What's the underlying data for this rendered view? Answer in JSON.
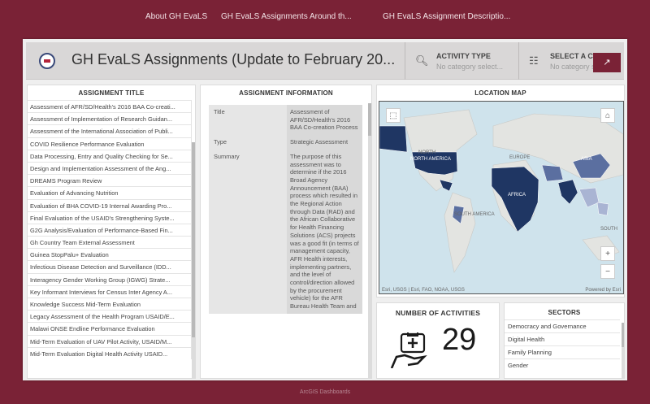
{
  "nav": {
    "items": [
      {
        "label": "About GH EvaLS"
      },
      {
        "label": "GH EvaLS Assignments Around th..."
      },
      {
        "label": "GH EvaLS Assignment Descriptio..."
      }
    ]
  },
  "header": {
    "title": "GH EvaLS Assignments (Update to February 20...",
    "activity_type": {
      "label": "ACTIVITY TYPE",
      "placeholder": "No category select..."
    },
    "country": {
      "label": "SELECT A CO",
      "placeholder": "No category se"
    }
  },
  "assignments": {
    "heading": "ASSIGNMENT TITLE",
    "items": [
      "Assessment of AFR/SD/Health's 2016 BAA Co-creati...",
      "Assessment of Implementation of Research Guidan...",
      "Assessment of the International Association of Publi...",
      "COVID Resilience Performance Evaluation",
      "Data Processing, Entry and Quality Checking for Se...",
      "Design and Implementation Assessment of the Ang...",
      "DREAMS Program Review",
      "Evaluation of Advancing Nutrition",
      "Evaluation of BHA COVID-19 Internal Awarding Pro...",
      "Final Evaluation of the USAID's Strengthening Syste...",
      "G2G Analysis/Evaluation of Performance-Based Fin...",
      "Gh Country Team External Assessment",
      "Guinea StopPalu+ Evaluation",
      "Infectious Disease Detection and Surveillance (IDD...",
      "Interagency Gender Working Group (IGWG) Strate...",
      "Key Informant Interviews for Census Inter Agency A...",
      "Knowledge Success Mid-Term Evaluation",
      "Legacy Assessment of the Health Program USAID/E...",
      "Malawi ONSE Endline Performance Evaluation",
      "Mid-Term Evaluation of UAV Pilot Activity, USAID/M...",
      "Mid-Term Evaluation Digital Health Activity USAID..."
    ]
  },
  "info": {
    "heading": "ASSIGNMENT INFORMATION",
    "rows": [
      {
        "key": "Title",
        "value": "Assessment of AFR/SD/Health's 2016 BAA Co-creation Process"
      },
      {
        "key": "Type",
        "value": "Strategic Assessment"
      },
      {
        "key": "Summary",
        "value": "The purpose of this assessment was to determine if the 2016 Broad Agency Announcement (BAA) process which resulted in the Regional Action through Data (RAD) and the African Collaborative for Health Financing Solutions (ACS) projects was a good fit (in terms of management capacity, AFR Health interests, implementing partners, and the level of control/direction allowed by the procurement vehicle) for the AFR Bureau Health Team and"
      }
    ]
  },
  "map": {
    "heading": "LOCATION MAP",
    "labels": {
      "north": "NORTH",
      "na": "NORTH AMERICA",
      "europe": "EUROPE",
      "asia": "ASIA",
      "africa": "AFRICA",
      "sa": "SOUTH AMERICA",
      "south": "SOUTH"
    },
    "attribution": "Esri, USGS | Esri, FAO, NOAA, USGS",
    "powered": "Powered by Esri",
    "zoom_in": "+",
    "zoom_out": "−"
  },
  "count": {
    "heading": "NUMBER OF ACTIVITIES",
    "value": "29"
  },
  "sectors": {
    "heading": "SECTORS",
    "items": [
      "Democracy and Governance",
      "Digital Health",
      "Family Planning",
      "Gender"
    ]
  },
  "caption": "ArcGIS Dashboards",
  "colors": {
    "brand": "#7a2236",
    "choropleth_dark": "#1f3663",
    "choropleth_mid": "#5b6fa0",
    "choropleth_light": "#a9b4d3"
  }
}
